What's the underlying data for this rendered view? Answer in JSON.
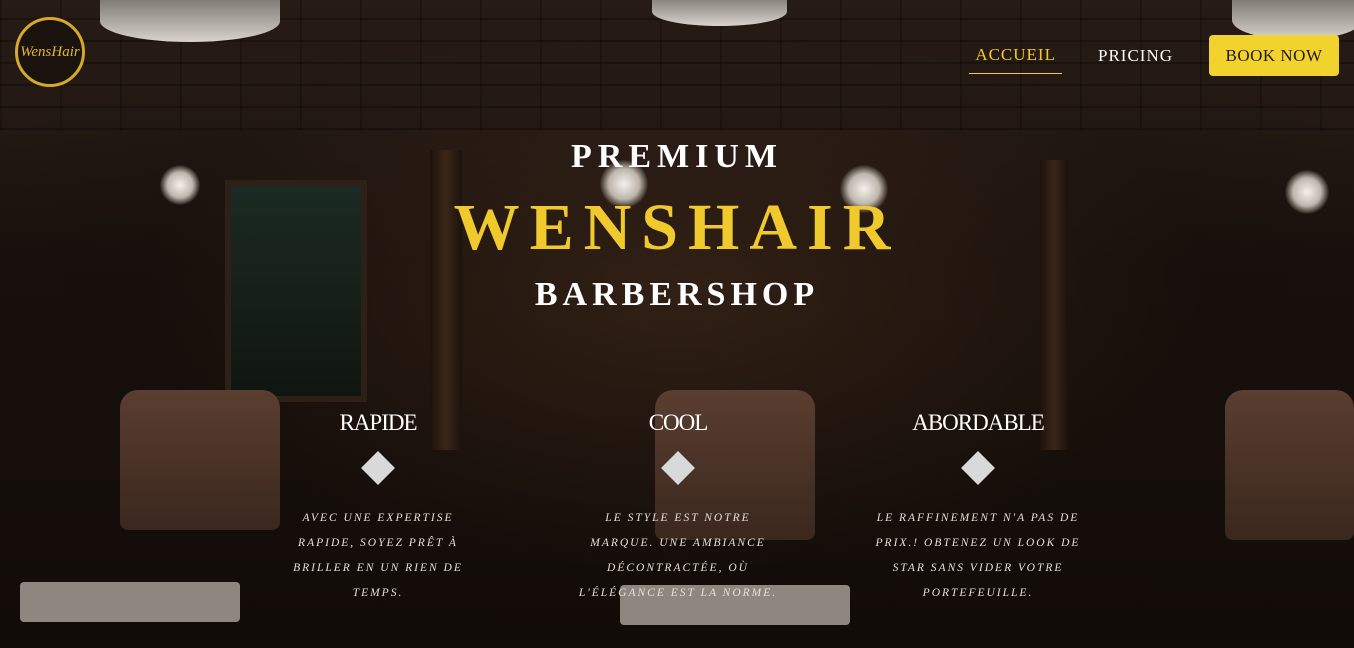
{
  "logo": {
    "text": "WensHair"
  },
  "nav": {
    "items": [
      {
        "label": "ACCUEIL",
        "active": true
      },
      {
        "label": "PRICING",
        "active": false
      }
    ],
    "cta_label": "BOOK NOW"
  },
  "hero": {
    "line1": "PREMIUM",
    "line2": "WENSHAIR",
    "line3": "BARBERSHOP"
  },
  "features": [
    {
      "title": "RAPIDE",
      "text": "Avec une expertise rapide, soyez prêt à briller en un rien de temps."
    },
    {
      "title": "COOL",
      "text": "Le style est notre marque. Une ambiance décontractée, où l'élégance est la norme."
    },
    {
      "title": "ABORDABLE",
      "text": "Le raffinement n'a pas de prix.! Obtenez un look de star sans vider votre portefeuille."
    }
  ],
  "colors": {
    "accent": "#f2d22c",
    "brand_gold": "#f0c92d",
    "background": "#140e0a"
  }
}
